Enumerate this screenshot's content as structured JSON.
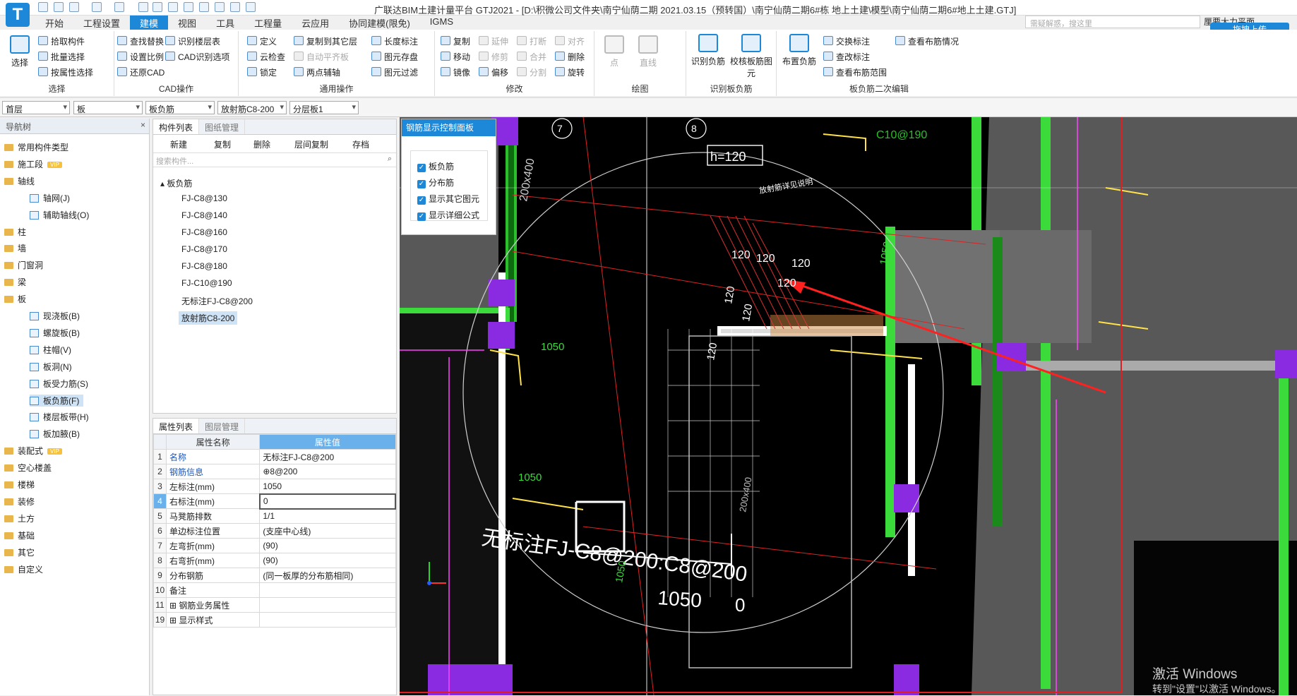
{
  "title": "广联达BIM土建计量平台 GTJ2021 - [D:\\积微公司文件夹\\南宁仙荫二期 2021.03.15（预转国）\\南宁仙荫二期6#栋 地上土建\\模型\\南宁仙荫二期6#地上土建.GTJ]",
  "top_search_placeholder": "需疑解惑，搜这里",
  "user": "厘要大力平面",
  "upload_label": "拖拽上传",
  "menu": [
    "开始",
    "工程设置",
    "建模",
    "视图",
    "工具",
    "工程量",
    "云应用",
    "协同建模(限免)",
    "IGMS"
  ],
  "ribbon": {
    "select_group": {
      "title": "选择",
      "big": "选择",
      "items": [
        "拾取构件",
        "批量选择",
        "按属性选择"
      ]
    },
    "cad_group": {
      "title": "CAD操作",
      "items": [
        "查找替换",
        "识别楼层表",
        "设置比例",
        "CAD识别选项",
        "还原CAD"
      ]
    },
    "general_group": {
      "title": "通用操作",
      "items": [
        "定义",
        "复制到其它层",
        "长度标注",
        "云检查",
        "自动平齐板",
        "图元存盘",
        "锁定",
        "两点辅轴",
        "图元过滤"
      ]
    },
    "modify_group": {
      "title": "修改",
      "items": [
        "复制",
        "延伸",
        "打断",
        "对齐",
        "移动",
        "修剪",
        "合并",
        "删除",
        "镜像",
        "偏移",
        "分割",
        "旋转"
      ]
    },
    "draw_group": {
      "title": "绘图",
      "items": [
        "点",
        "直线"
      ]
    },
    "recog_group": {
      "title": "识别板负筋",
      "items": [
        "识别负筋",
        "校核板筋图元"
      ]
    },
    "second_group": {
      "title": "板负筋二次编辑",
      "items": [
        "布置负筋",
        "交换标注",
        "查看布筋情况",
        "查改标注",
        "查看布筋范围"
      ]
    }
  },
  "filters": [
    "首层",
    "板",
    "板负筋",
    "放射筋C8-200",
    "分层板1"
  ],
  "nav": {
    "title": "导航树",
    "items": [
      {
        "label": "常用构件类型",
        "level": 0
      },
      {
        "label": "施工段",
        "level": 0,
        "vip": "VIP"
      },
      {
        "label": "轴线",
        "level": 0
      },
      {
        "label": "轴网(J)",
        "level": 1
      },
      {
        "label": "辅助轴线(O)",
        "level": 1
      },
      {
        "label": "柱",
        "level": 0
      },
      {
        "label": "墙",
        "level": 0
      },
      {
        "label": "门窗洞",
        "level": 0
      },
      {
        "label": "梁",
        "level": 0
      },
      {
        "label": "板",
        "level": 0
      },
      {
        "label": "现浇板(B)",
        "level": 1
      },
      {
        "label": "螺旋板(B)",
        "level": 1
      },
      {
        "label": "柱帽(V)",
        "level": 1
      },
      {
        "label": "板洞(N)",
        "level": 1
      },
      {
        "label": "板受力筋(S)",
        "level": 1
      },
      {
        "label": "板负筋(F)",
        "level": 1,
        "selected": true
      },
      {
        "label": "楼层板带(H)",
        "level": 1
      },
      {
        "label": "板加腋(B)",
        "level": 1
      },
      {
        "label": "装配式",
        "level": 0,
        "vip": "VIP"
      },
      {
        "label": "空心楼盖",
        "level": 0
      },
      {
        "label": "楼梯",
        "level": 0
      },
      {
        "label": "装修",
        "level": 0
      },
      {
        "label": "土方",
        "level": 0
      },
      {
        "label": "基础",
        "level": 0
      },
      {
        "label": "其它",
        "level": 0
      },
      {
        "label": "自定义",
        "level": 0
      }
    ]
  },
  "component_list": {
    "tabs": [
      "构件列表",
      "图纸管理"
    ],
    "toolbar": [
      "新建",
      "复制",
      "删除",
      "层间复制",
      "存档"
    ],
    "search_placeholder": "搜索构件...",
    "root": "板负筋",
    "items": [
      "FJ-C8@130",
      "FJ-C8@140",
      "FJ-C8@160",
      "FJ-C8@170",
      "FJ-C8@180",
      "FJ-C10@190",
      "无标注FJ-C8@200",
      "放射筋C8-200"
    ],
    "selected": "放射筋C8-200"
  },
  "properties": {
    "tabs": [
      "属性列表",
      "图层管理"
    ],
    "headers": [
      "属性名称",
      "属性值"
    ],
    "rows": [
      {
        "no": "1",
        "name": "名称",
        "value": "无标注FJ-C8@200",
        "blue": true
      },
      {
        "no": "2",
        "name": "钢筋信息",
        "value": "⊕8@200",
        "blue": true
      },
      {
        "no": "3",
        "name": "左标注(mm)",
        "value": "1050"
      },
      {
        "no": "4",
        "name": "右标注(mm)",
        "value": "0",
        "current": true
      },
      {
        "no": "5",
        "name": "马凳筋排数",
        "value": "1/1"
      },
      {
        "no": "6",
        "name": "单边标注位置",
        "value": "(支座中心线)"
      },
      {
        "no": "7",
        "name": "左弯折(mm)",
        "value": "(90)"
      },
      {
        "no": "8",
        "name": "右弯折(mm)",
        "value": "(90)"
      },
      {
        "no": "9",
        "name": "分布钢筋",
        "value": "(同一板厚的分布筋相同)"
      },
      {
        "no": "10",
        "name": "备注",
        "value": ""
      },
      {
        "no": "11",
        "name": "⊞ 钢筋业务属性",
        "value": ""
      },
      {
        "no": "19",
        "name": "⊞ 显示样式",
        "value": ""
      }
    ]
  },
  "rebar_panel": {
    "title": "钢筋显示控制面板",
    "options": [
      "板负筋",
      "分布筋",
      "显示其它图元",
      "显示详细公式"
    ]
  },
  "cad": {
    "axis_labels": [
      "7",
      "8"
    ],
    "thickness": "h=120",
    "big_label": "无标注FJ-C8@200:C8@200",
    "dims": [
      "1050",
      "0"
    ],
    "small_labels": [
      "200x400",
      "C10@190",
      "1050",
      "1050",
      "1050",
      "1050",
      "120",
      "120",
      "120",
      "120",
      "120",
      "120",
      "120",
      "放射筋详见说明",
      "200x400"
    ]
  },
  "watermark": [
    "激活 Windows",
    "转到\"设置\"以激活 Windows。"
  ]
}
